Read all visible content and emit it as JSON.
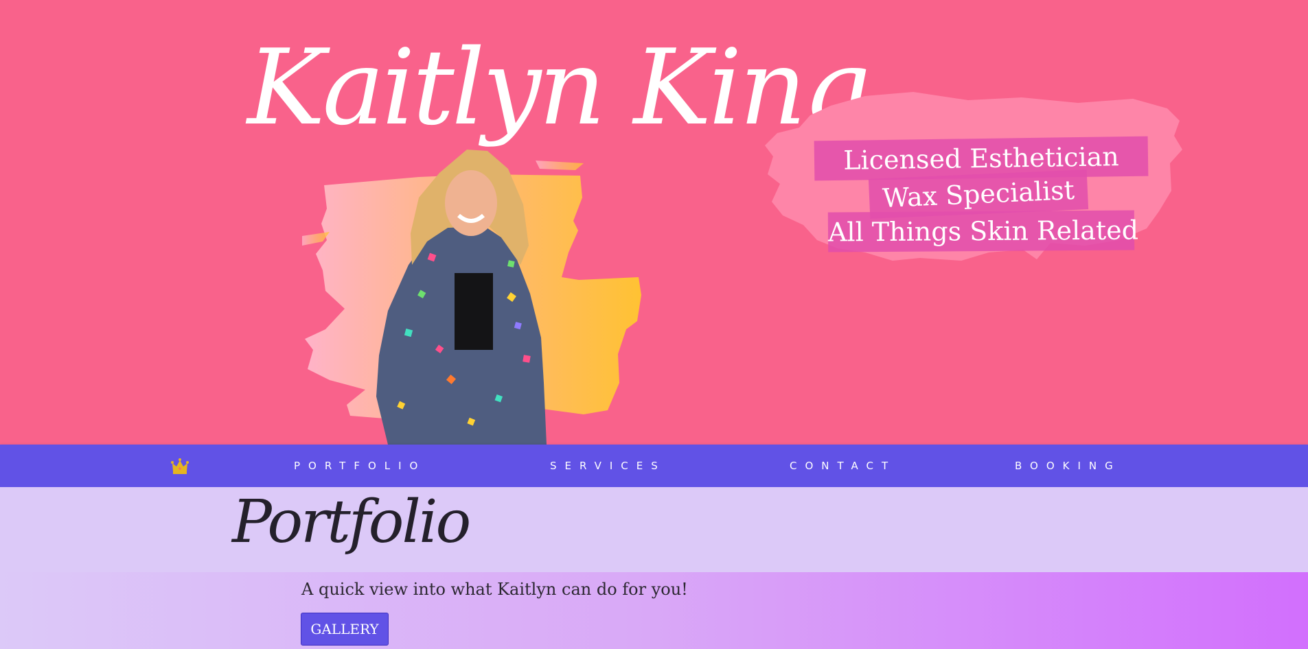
{
  "hero": {
    "title": "Kaitlyn King",
    "taglines": [
      "Licensed Esthetician",
      "Wax Specialist",
      "All Things Skin Related"
    ]
  },
  "nav": {
    "home_icon": "crown-icon",
    "items": [
      {
        "label": "PORTFOLIO"
      },
      {
        "label": "SERVICES"
      },
      {
        "label": "CONTACT"
      },
      {
        "label": "BOOKING"
      }
    ]
  },
  "portfolio": {
    "title": "Portfolio",
    "subtitle": "A quick view into what Kaitlyn can do for you!",
    "button_label": "GALLERY"
  },
  "colors": {
    "hero_background": "#f9628b",
    "nav_background": "#6152e6",
    "tagline_highlight": "#e24eac",
    "section_background": "#dcc9f8",
    "gradient_end": "#d26ffd",
    "crown": "#e5b520"
  }
}
